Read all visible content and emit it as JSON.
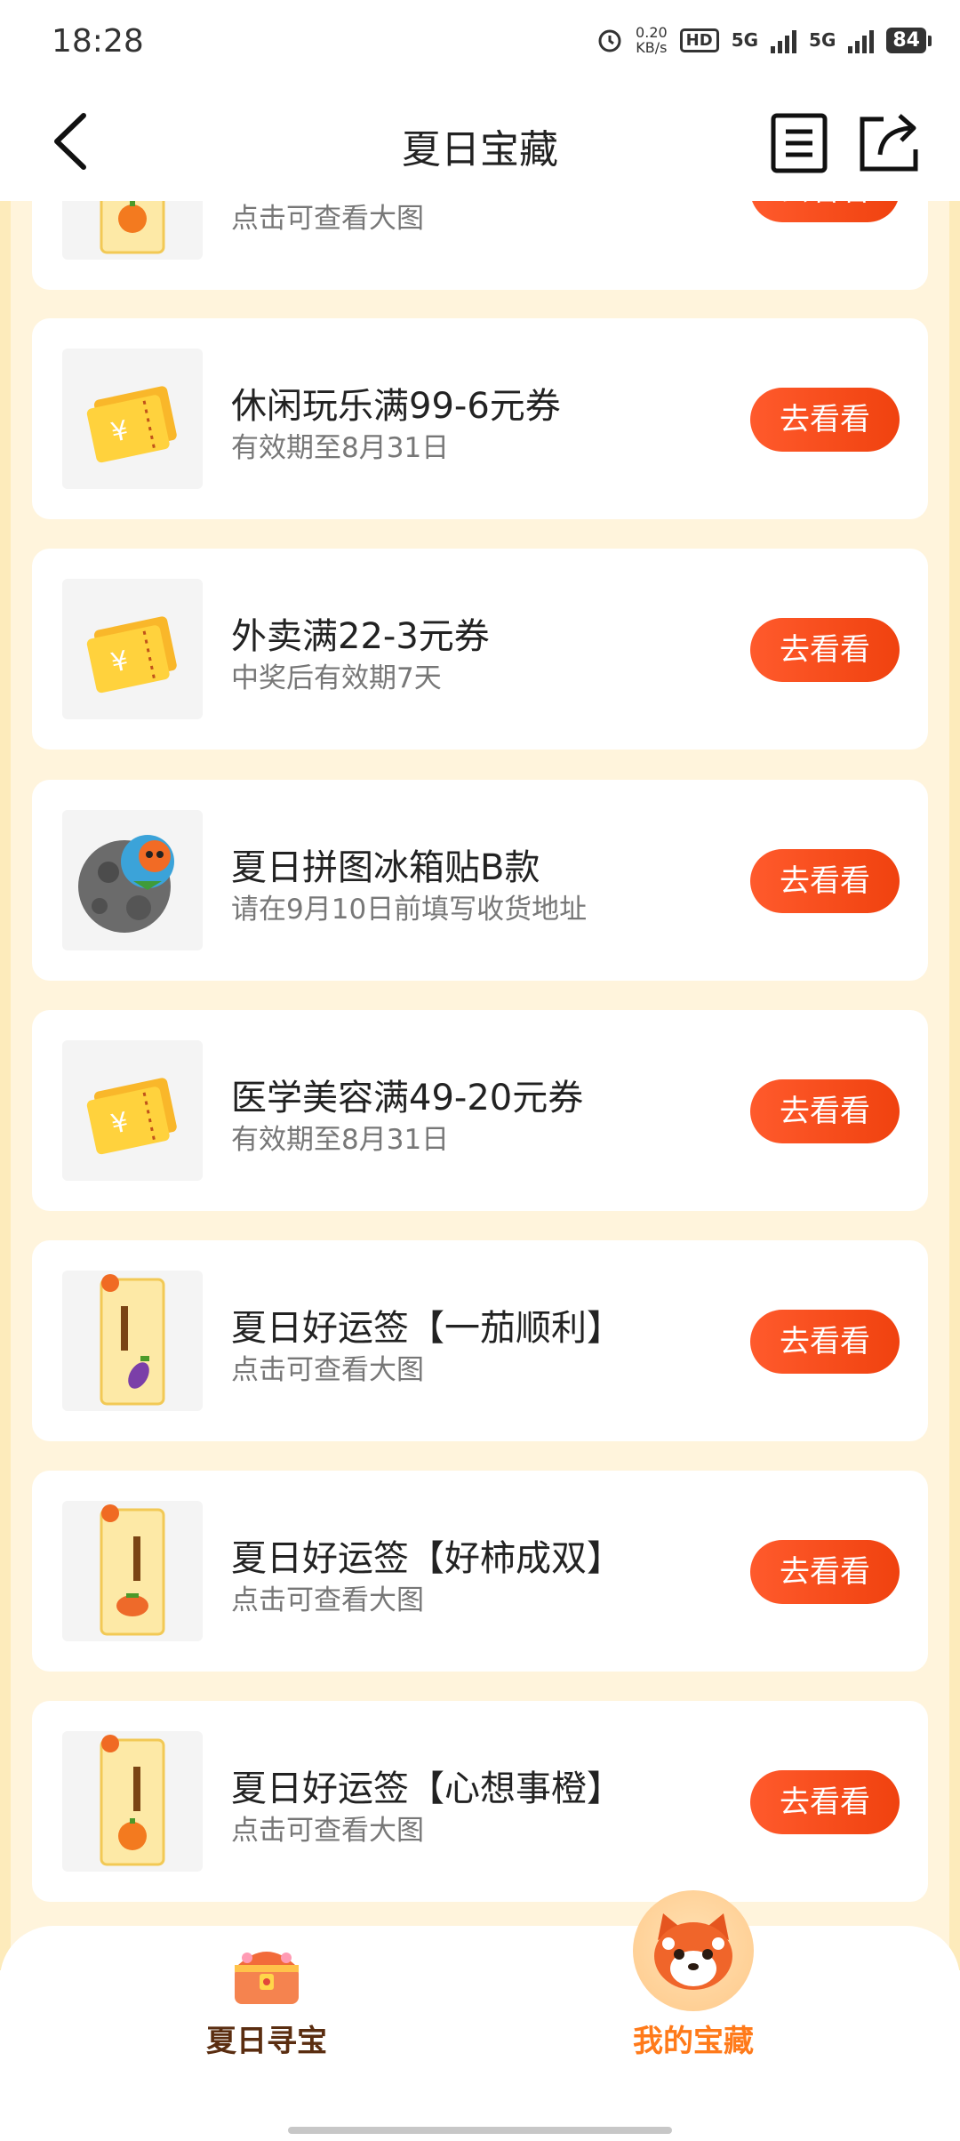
{
  "status_bar": {
    "time": "18:28",
    "net_speed_value": "0.20",
    "net_speed_unit": "KB/s",
    "hd_label": "HD",
    "sim1_label": "5G",
    "sim2_label": "5G",
    "battery": "84"
  },
  "header": {
    "title": "夏日宝藏",
    "back_icon": "chevron-left-icon",
    "list_icon": "document-list-icon",
    "share_icon": "share-icon"
  },
  "items": [
    {
      "title": "",
      "subtitle": "点击可查看大图",
      "button": "去看看",
      "thumb": "fortune-card-orange"
    },
    {
      "title": "休闲玩乐满99-6元券",
      "subtitle": "有效期至8月31日",
      "button": "去看看",
      "thumb": "coupon-ticket"
    },
    {
      "title": "外卖满22-3元券",
      "subtitle": "中奖后有效期7天",
      "button": "去看看",
      "thumb": "coupon-ticket"
    },
    {
      "title": "夏日拼图冰箱贴B款",
      "subtitle": "请在9月10日前填写收货地址",
      "button": "去看看",
      "thumb": "fridge-magnet"
    },
    {
      "title": "医学美容满49-20元券",
      "subtitle": "有效期至8月31日",
      "button": "去看看",
      "thumb": "coupon-ticket"
    },
    {
      "title": "夏日好运签【一茄顺利】",
      "subtitle": "点击可查看大图",
      "button": "去看看",
      "thumb": "fortune-card-eggplant"
    },
    {
      "title": "夏日好运签【好柿成双】",
      "subtitle": "点击可查看大图",
      "button": "去看看",
      "thumb": "fortune-card-persimmon"
    },
    {
      "title": "夏日好运签【心想事橙】",
      "subtitle": "点击可查看大图",
      "button": "去看看",
      "thumb": "fortune-card-orange"
    }
  ],
  "bottom_nav": {
    "left_label": "夏日寻宝",
    "left_icon": "treasure-chest-icon",
    "right_label": "我的宝藏",
    "right_icon": "red-panda-icon"
  },
  "colors": {
    "accent": "#f04a14",
    "background": "#fdebbb",
    "nav_active": "#ff7a1a",
    "nav_inactive": "#5a2d10"
  }
}
